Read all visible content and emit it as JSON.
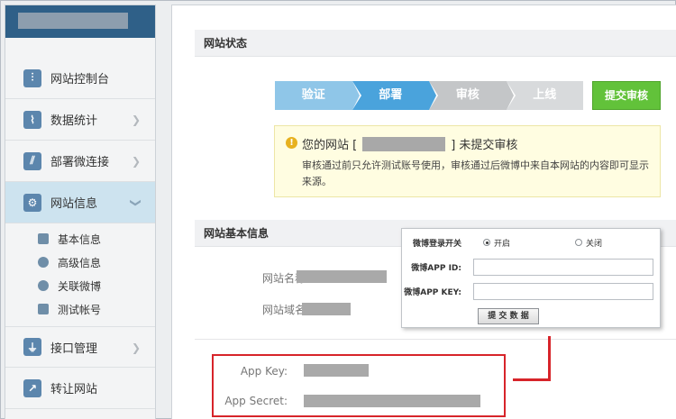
{
  "sidebar": {
    "items": [
      {
        "label": "网站控制台",
        "icon": "dashboard-icon"
      },
      {
        "label": "数据统计",
        "icon": "chart-icon"
      },
      {
        "label": "部署微连接",
        "icon": "link-icon"
      },
      {
        "label": "网站信息",
        "icon": "gear-icon",
        "active": true
      },
      {
        "label": "接口管理",
        "icon": "plug-icon"
      },
      {
        "label": "转让网站",
        "icon": "share-icon"
      }
    ],
    "sub_items": [
      {
        "label": "基本信息",
        "icon": "card-icon"
      },
      {
        "label": "高级信息",
        "icon": "info-icon"
      },
      {
        "label": "关联微博",
        "icon": "weibo-icon"
      },
      {
        "label": "测试帐号",
        "icon": "user-card-icon"
      }
    ]
  },
  "status_section": {
    "title": "网站状态",
    "steps": [
      "验证",
      "部署",
      "审核",
      "上线"
    ],
    "submit_label": "提交审核",
    "notice": {
      "prefix": "您的网站 [",
      "suffix": "] 未提交审核",
      "detail": "审核通过前只允许测试账号使用，审核通过后微博中来自本网站的内容即可显示来源。"
    }
  },
  "basic_section": {
    "title": "网站基本信息",
    "site_name_label": "网站名称:",
    "site_domain_label": "网站域名:",
    "app_key_label": "App Key:",
    "app_secret_label": "App Secret:"
  },
  "overlay_form": {
    "switch_label": "微博登录开关",
    "option_on": "开启",
    "option_off": "关闭",
    "app_id_label": "微博APP ID:",
    "app_key_label": "微博APP KEY:",
    "submit_label": "提 交 数 据"
  },
  "colors": {
    "sidebar_header": "#2f6088",
    "step_active": "#4aa3dc",
    "submit_green": "#62c23a",
    "annotation_red": "#d7242a"
  }
}
